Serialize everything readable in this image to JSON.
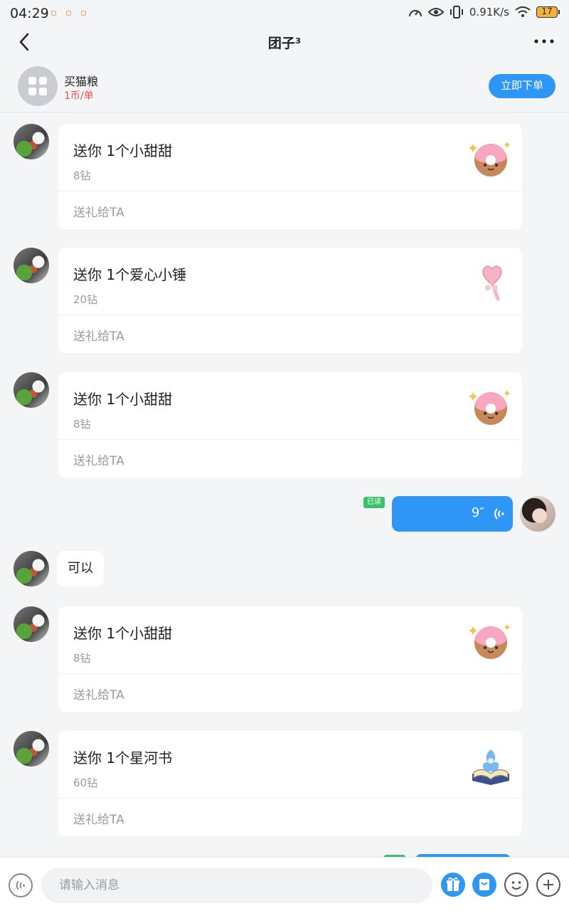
{
  "status_bar": {
    "time": "04:29",
    "net_speed": "0.91K/s",
    "battery": "17"
  },
  "header": {
    "title": "团子³"
  },
  "order": {
    "name": "买猫粮",
    "price": "1币/单",
    "button_label": "立即下单"
  },
  "messages": [
    {
      "type": "gift",
      "title": "送你 1个小甜甜",
      "price": "8钻",
      "action": "送礼给TA",
      "icon": "donut-icon"
    },
    {
      "type": "gift",
      "title": "送你 1个爱心小锤",
      "price": "20钻",
      "action": "送礼给TA",
      "icon": "heart-hammer-icon"
    },
    {
      "type": "gift",
      "title": "送你 1个小甜甜",
      "price": "8钻",
      "action": "送礼给TA",
      "icon": "donut-icon"
    },
    {
      "type": "voice",
      "read_label": "已读",
      "duration": "9″"
    },
    {
      "type": "text",
      "text": "可以"
    },
    {
      "type": "gift",
      "title": "送你 1个小甜甜",
      "price": "8钻",
      "action": "送礼给TA",
      "icon": "donut-icon"
    },
    {
      "type": "gift",
      "title": "送你 1个星河书",
      "price": "60钻",
      "action": "送礼给TA",
      "icon": "star-book-icon"
    }
  ],
  "input": {
    "placeholder": "请输入消息"
  },
  "colors": {
    "accent": "#2e97f5",
    "price_red": "#f24d4d",
    "read_green": "#3dbf6c"
  }
}
